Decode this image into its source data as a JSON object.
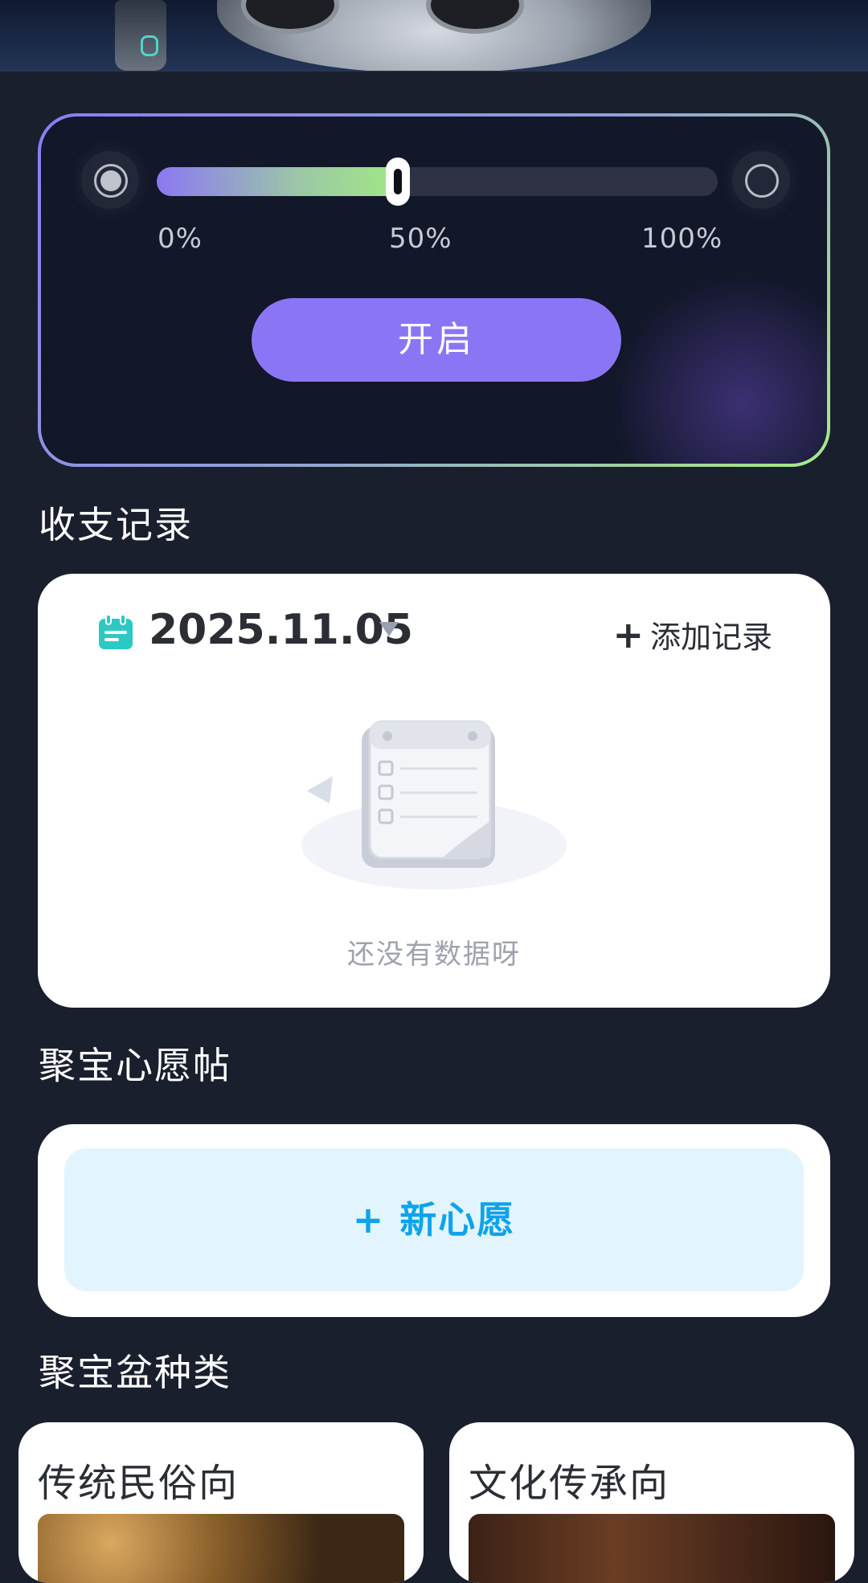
{
  "control": {
    "progress_percent": 43,
    "labels": {
      "min": "0%",
      "mid": "50%",
      "max": "100%"
    },
    "button_label": "开启"
  },
  "records": {
    "section_title": "收支记录",
    "date": "2025.11.05",
    "add_label": "添加记录",
    "add_plus": "+",
    "empty_text": "还没有数据呀"
  },
  "wishes": {
    "section_title": "聚宝心愿帖",
    "new_wish_label": "+ 新心愿"
  },
  "categories": {
    "section_title": "聚宝盆种类",
    "items": [
      {
        "label": "传统民俗向"
      },
      {
        "label": "文化传承向"
      }
    ]
  },
  "colors": {
    "background": "#1a1f2e",
    "accent_purple": "#8a76f5",
    "accent_green": "#a1e785",
    "wish_blue": "#0ea3ea",
    "calendar_teal": "#2cc9c4"
  },
  "icons": {
    "calendar": "calendar-icon",
    "caret": "caret-down-icon",
    "plus": "plus-icon",
    "empty": "empty-clipboard-icon"
  }
}
